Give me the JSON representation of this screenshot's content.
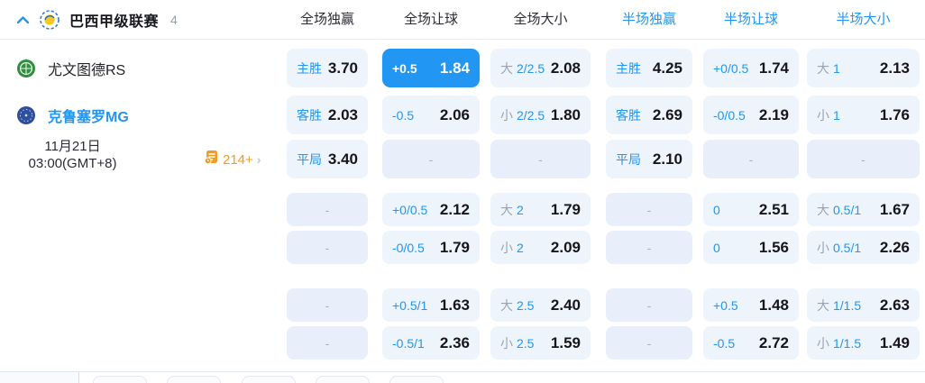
{
  "header": {
    "league_name": "巴西甲级联赛",
    "match_count": "4",
    "columns": [
      {
        "key": "full-1x2",
        "label": "全场独赢",
        "scope": "full"
      },
      {
        "key": "full-handicap",
        "label": "全场让球",
        "scope": "full"
      },
      {
        "key": "full-ou",
        "label": "全场大小",
        "scope": "full"
      },
      {
        "key": "half-1x2",
        "label": "半场独赢",
        "scope": "half"
      },
      {
        "key": "half-handicap",
        "label": "半场让球",
        "scope": "half"
      },
      {
        "key": "half-ou",
        "label": "半场大小",
        "scope": "half"
      }
    ]
  },
  "match": {
    "home_team": "尤文图德RS",
    "away_team": "克鲁塞罗MG",
    "date": "11月21日",
    "time": "03:00(GMT+8)",
    "more_markets_count": "214+"
  },
  "colors": {
    "accent_blue": "#2196f3",
    "cell_bg": "#eef4fb",
    "dash_cell_bg": "#e9effa",
    "gray_label": "#9aa3b0",
    "orange": "#f59a23"
  },
  "odds_rows": [
    {
      "cells": [
        {
          "label": "主胜",
          "value": "3.70"
        },
        {
          "label": "+0.5",
          "value": "1.84",
          "highlighted": true
        },
        {
          "prefix": "大",
          "label": "2/2.5",
          "value": "2.08"
        },
        {
          "label": "主胜",
          "value": "4.25"
        },
        {
          "label": "+0/0.5",
          "value": "1.74"
        },
        {
          "prefix": "大",
          "label": "1",
          "value": "2.13"
        }
      ]
    },
    {
      "cells": [
        {
          "label": "客胜",
          "value": "2.03"
        },
        {
          "label": "-0.5",
          "value": "2.06"
        },
        {
          "prefix": "小",
          "label": "2/2.5",
          "value": "1.80"
        },
        {
          "label": "客胜",
          "value": "2.69"
        },
        {
          "label": "-0/0.5",
          "value": "2.19"
        },
        {
          "prefix": "小",
          "label": "1",
          "value": "1.76"
        }
      ]
    },
    {
      "cells": [
        {
          "label": "平局",
          "value": "3.40"
        },
        {
          "dash": true
        },
        {
          "dash": true
        },
        {
          "label": "平局",
          "value": "2.10"
        },
        {
          "dash": true
        },
        {
          "dash": true
        }
      ]
    },
    {
      "cells": [
        {
          "dash": true
        },
        {
          "label": "+0/0.5",
          "value": "2.12"
        },
        {
          "prefix": "大",
          "label": "2",
          "value": "1.79"
        },
        {
          "dash": true
        },
        {
          "label": "0",
          "value": "2.51"
        },
        {
          "prefix": "大",
          "label": "0.5/1",
          "value": "1.67"
        }
      ]
    },
    {
      "cells": [
        {
          "dash": true
        },
        {
          "label": "-0/0.5",
          "value": "1.79"
        },
        {
          "prefix": "小",
          "label": "2",
          "value": "2.09"
        },
        {
          "dash": true
        },
        {
          "label": "0",
          "value": "1.56"
        },
        {
          "prefix": "小",
          "label": "0.5/1",
          "value": "2.26"
        }
      ]
    },
    {
      "cells": [
        {
          "dash": true
        },
        {
          "label": "+0.5/1",
          "value": "1.63"
        },
        {
          "prefix": "大",
          "label": "2.5",
          "value": "2.40"
        },
        {
          "dash": true
        },
        {
          "label": "+0.5",
          "value": "1.48"
        },
        {
          "prefix": "大",
          "label": "1/1.5",
          "value": "2.63"
        }
      ]
    },
    {
      "cells": [
        {
          "dash": true
        },
        {
          "label": "-0.5/1",
          "value": "2.36"
        },
        {
          "prefix": "小",
          "label": "2.5",
          "value": "1.59"
        },
        {
          "dash": true
        },
        {
          "label": "-0.5",
          "value": "2.72"
        },
        {
          "prefix": "小",
          "label": "1/1.5",
          "value": "1.49"
        }
      ]
    }
  ]
}
